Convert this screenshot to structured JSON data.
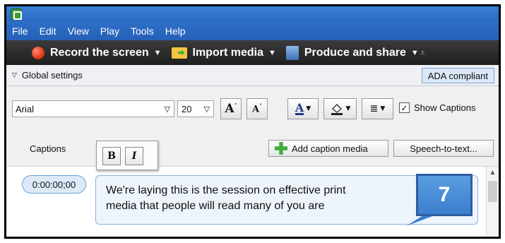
{
  "menu": [
    "File",
    "Edit",
    "View",
    "Play",
    "Tools",
    "Help"
  ],
  "tasks": {
    "record": "Record the screen",
    "import": "Import media",
    "produce": "Produce and share"
  },
  "global_settings": {
    "label": "Global settings",
    "ada_button": "ADA compliant"
  },
  "font": {
    "family": "Arial",
    "size": "20",
    "show_captions_label": "Show Captions",
    "show_captions_checked": true
  },
  "captions": {
    "tab_label": "Captions",
    "format_bold": "B",
    "format_italic": "I",
    "add_caption_media": "Add caption media",
    "speech_to_text": "Speech-to-text...",
    "items": [
      {
        "time": "0:00:00;00",
        "line1": "We're laying this is the session on effective print",
        "line2": "media that people will read many of you are"
      }
    ]
  },
  "annotation": {
    "callout_number": "7"
  },
  "colors": {
    "titlebar": "#2b6ac3",
    "toolbar_dark": "#1e1e1e",
    "callout": "#3b7fcf"
  }
}
